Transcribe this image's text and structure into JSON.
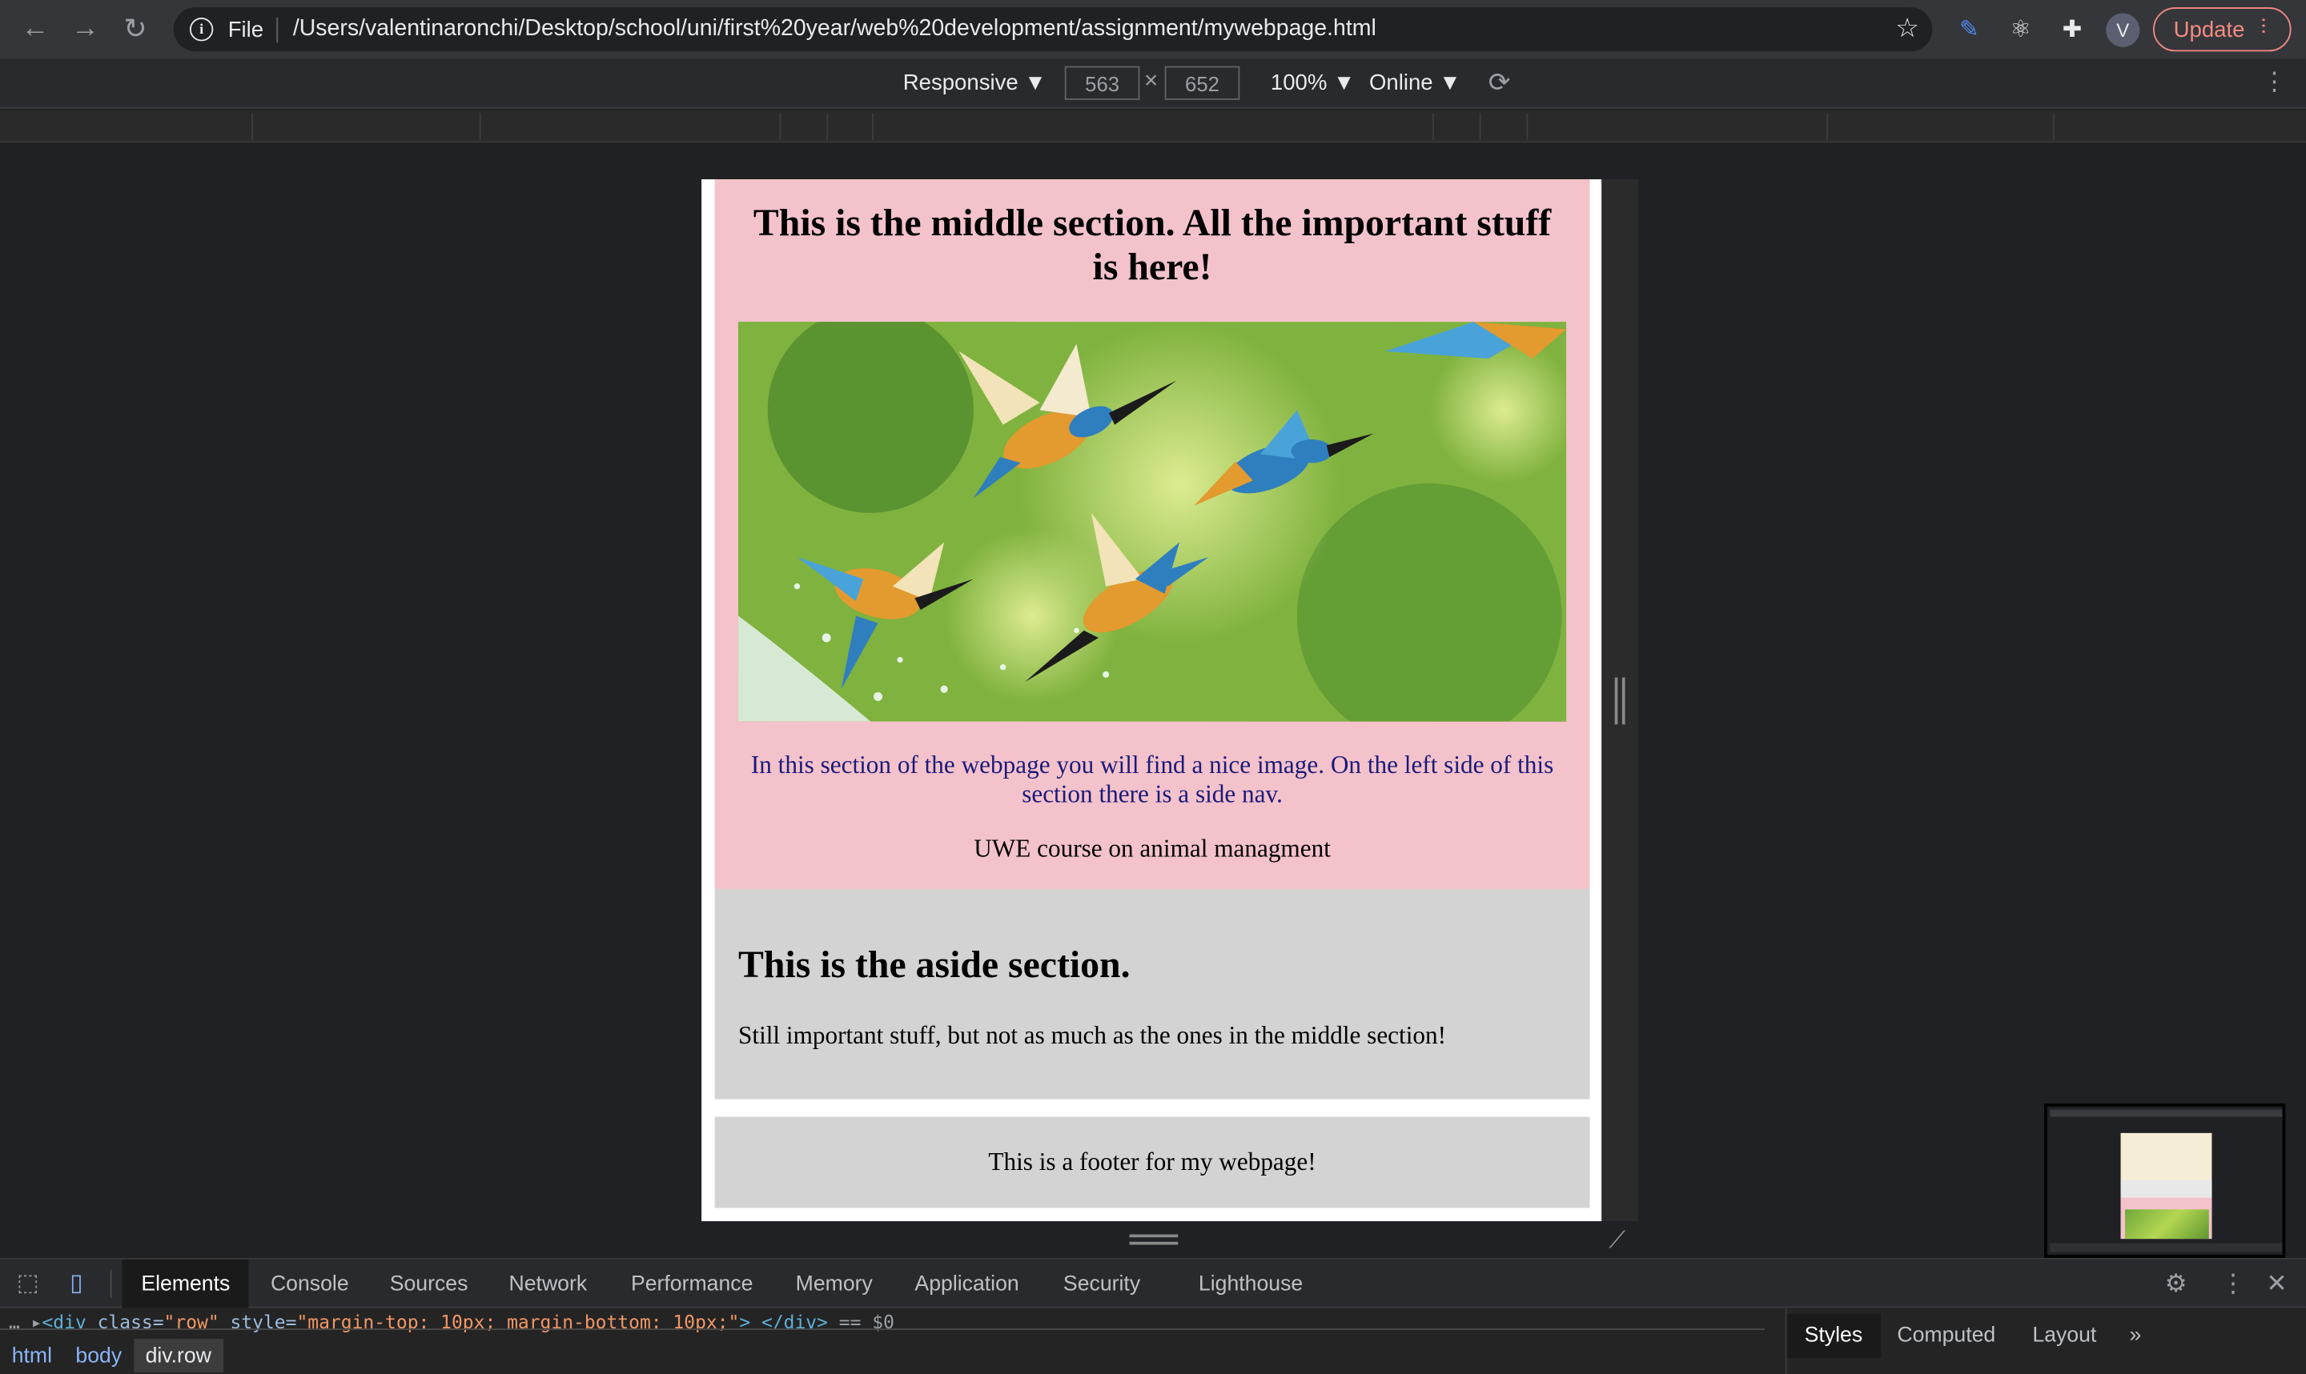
{
  "browser": {
    "url_scheme": "File",
    "url": "/Users/valentinaronchi/Desktop/school/uni/first%20year/web%20development/assignment/mywebpage.html",
    "avatar_letter": "V",
    "update_label": "Update"
  },
  "device_toolbar": {
    "mode": "Responsive ▼",
    "width": "563",
    "height": "652",
    "times": "×",
    "zoom": "100% ▼",
    "network": "Online ▼"
  },
  "page": {
    "middle_heading": "This is the middle section. All the important stuff is here!",
    "middle_paragraph": "In this section of the webpage you will find a nice image. On the left side of this section there is a side nav.",
    "middle_link": "UWE course on animal managment",
    "aside_heading": "This is the aside section.",
    "aside_paragraph": "Still important stuff, but not as much as the ones in the middle section!",
    "footer_text": "This is a footer for my webpage!"
  },
  "devtools": {
    "tabs": [
      "Elements",
      "Console",
      "Sources",
      "Network",
      "Performance",
      "Memory",
      "Application",
      "Security",
      "Lighthouse"
    ],
    "active_tab": "Elements",
    "dom_line": {
      "prefix": "… ▸",
      "tag_open": "<div",
      "attr_class": " class=",
      "class_val": "\"row\"",
      "attr_style": " style=",
      "style_val": "\"margin-top: 10px; margin-bottom: 10px;\"",
      "tag_close": "> </div>",
      "suffix": " == $0"
    },
    "breadcrumbs": [
      "html",
      "body",
      "div.row"
    ],
    "side_tabs": [
      "Styles",
      "Computed",
      "Layout"
    ],
    "side_more": "»"
  },
  "colors": {
    "middle_bg": "#f4c2cb",
    "aside_bg": "#d3d3d3",
    "footer_bg": "#d3d3d3",
    "paragraph_text": "#1a1a7a",
    "update_accent": "#f28b82",
    "devtools_accent": "#8ab4f8"
  }
}
